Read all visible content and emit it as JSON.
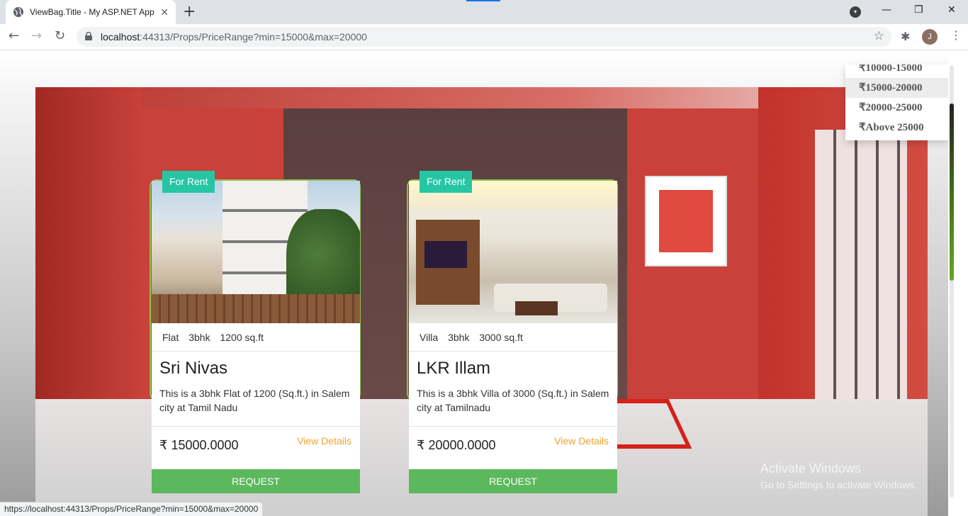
{
  "browser": {
    "tab_title": "ViewBag.Title - My ASP.NET Appl",
    "tab_close": "✕",
    "new_tab": "+",
    "window_controls": {
      "minimize": "—",
      "restore": "❐",
      "close": "✕"
    },
    "profile_dd": "▾",
    "nav": {
      "back": "←",
      "forward": "→",
      "reload": "↻"
    },
    "url_host": "localhost",
    "url_rest": ":44313/Props/PriceRange?min=15000&max=20000",
    "bookmark_star": "☆",
    "extensions_icon": "✱",
    "avatar_letter": "J",
    "menu": "⋮",
    "status_url": "https://localhost:44313/Props/PriceRange?min=15000&max=20000"
  },
  "price_dropdown": {
    "items": [
      "₹10000-15000",
      "₹15000-20000",
      "₹20000-25000",
      "₹Above 25000"
    ],
    "active_index": 1
  },
  "properties": [
    {
      "badge": "For Rent",
      "type": "Flat",
      "bhk": "3bhk",
      "area": "1200 sq.ft",
      "name": "Sri Nivas",
      "description": "This is a 3bhk Flat of 1200 (Sq.ft.) in Salem city at Tamil Nadu",
      "price": "₹ 15000.0000",
      "details_label": "View Details",
      "request_label": "REQUEST"
    },
    {
      "badge": "For Rent",
      "type": "Villa",
      "bhk": "3bhk",
      "area": "3000 sq.ft",
      "name": "LKR Illam",
      "description": "This is a 3bhk Villa of 3000 (Sq.ft.) in Salem city at Tamilnadu",
      "price": "₹ 20000.0000",
      "details_label": "View Details",
      "request_label": "REQUEST"
    }
  ],
  "watermark": {
    "line1": "Activate Windows",
    "line2": "Go to Settings to activate Windows."
  },
  "colors": {
    "badge": "#26c6a5",
    "request_button": "#5cb85c",
    "details_link": "#f0a32e",
    "card_border": "#8bc34a"
  }
}
